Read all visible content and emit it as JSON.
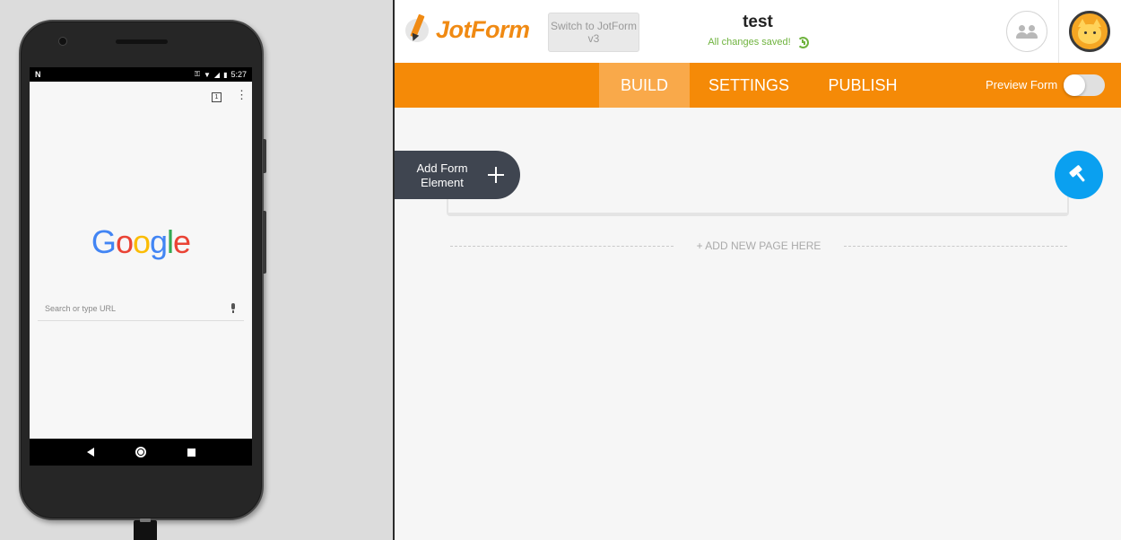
{
  "phone": {
    "status": {
      "notification_glyph": "N",
      "time": "5:27"
    },
    "browser": {
      "tab_count": "1",
      "menu_glyph": "⋮",
      "logo_letters": [
        "G",
        "o",
        "o",
        "g",
        "l",
        "e"
      ],
      "search_placeholder": "Search or type URL"
    }
  },
  "jotform": {
    "logo_text": "JotForm",
    "switch_button": "Switch to JotForm v3",
    "form_title": "test",
    "save_status": "All changes saved!",
    "tabs": [
      {
        "label": "BUILD",
        "active": true
      },
      {
        "label": "SETTINGS",
        "active": false
      },
      {
        "label": "PUBLISH",
        "active": false
      }
    ],
    "preview_form_label": "Preview Form",
    "preview_form_on": false,
    "add_element_label": "Add Form Element",
    "add_page_label": "+ ADD NEW PAGE HERE"
  },
  "colors": {
    "brand_orange": "#f58a07",
    "active_tab": "#f9a94a",
    "designer_blue": "#0aa0f0",
    "save_green": "#6fb33e",
    "dark_button": "#3f4550"
  }
}
